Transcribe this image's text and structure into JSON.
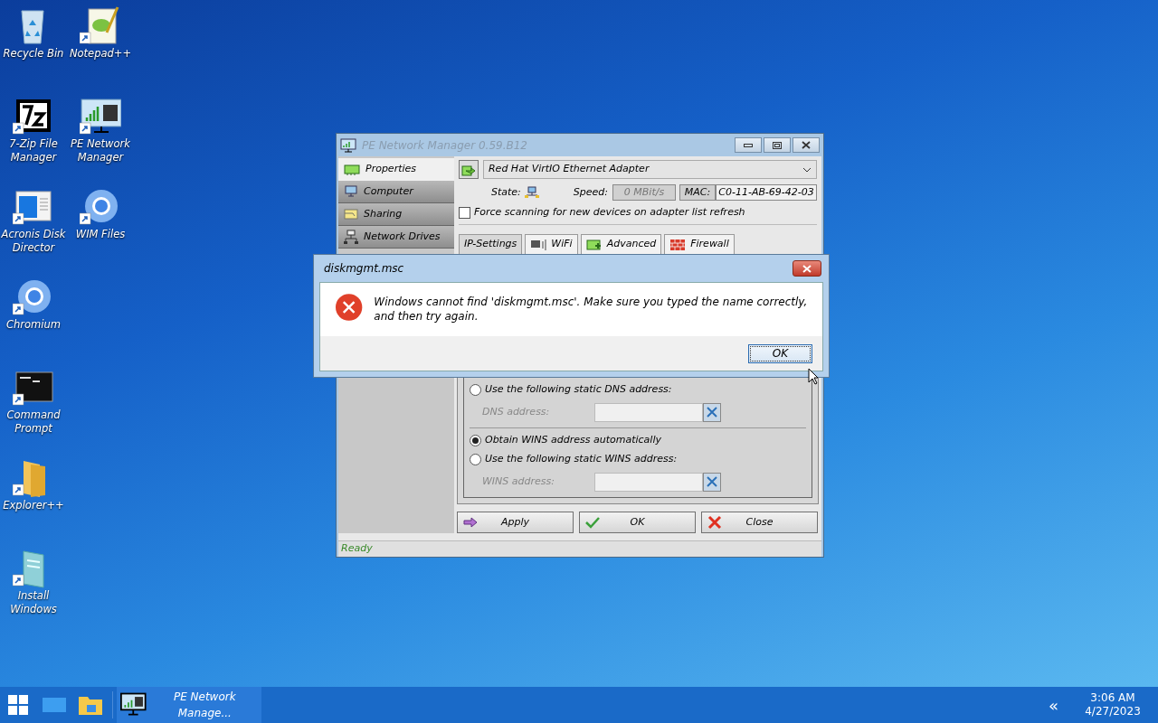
{
  "desktop_icons": [
    {
      "label": "Recycle Bin",
      "shortcut": false
    },
    {
      "label": "7-Zip File Manager",
      "shortcut": true
    },
    {
      "label": "Acronis Disk Director",
      "shortcut": true
    },
    {
      "label": "Chromium",
      "shortcut": true
    },
    {
      "label": "Command Prompt",
      "shortcut": true
    },
    {
      "label": "Explorer++",
      "shortcut": true
    },
    {
      "label": "Install Windows",
      "shortcut": true
    },
    {
      "label": "Notepad++",
      "shortcut": true
    },
    {
      "label": "PE Network Manager",
      "shortcut": true
    },
    {
      "label": "WIM Files",
      "shortcut": true
    }
  ],
  "main_window": {
    "title": "PE Network Manager 0.59.B12",
    "nav": [
      {
        "label": "Properties",
        "selected": true
      },
      {
        "label": "Computer",
        "selected": false
      },
      {
        "label": "Sharing",
        "selected": false
      },
      {
        "label": "Network Drives",
        "selected": false
      }
    ],
    "adapter": "Red Hat VirtIO Ethernet Adapter",
    "state_label": "State:",
    "speed_label": "Speed:",
    "speed": "0 MBit/s",
    "mac_label": "MAC:",
    "mac": "C0-11-AB-69-42-03",
    "force_scan": {
      "label": "Force scanning for new devices on adapter list refresh",
      "checked": false
    },
    "tabs": [
      {
        "label": "IP-Settings",
        "selected": true
      },
      {
        "label": "WiFi",
        "selected": false
      },
      {
        "label": "Advanced",
        "selected": false
      },
      {
        "label": "Firewall",
        "selected": false
      }
    ],
    "sections": [
      {
        "options": [
          {
            "label": "Use the following static DNS address:",
            "selected": false
          }
        ],
        "field_label": "DNS address:"
      },
      {
        "options": [
          {
            "label": "Obtain WINS address automatically",
            "selected": true
          },
          {
            "label": "Use the following static WINS address:",
            "selected": false
          }
        ],
        "field_label": "WINS address:"
      }
    ],
    "buttons": [
      {
        "label": "Apply",
        "kind": "apply"
      },
      {
        "label": "OK",
        "kind": "ok"
      },
      {
        "label": "Close",
        "kind": "close"
      }
    ],
    "status": "Ready"
  },
  "dialog": {
    "title": "diskmgmt.msc",
    "message": "Windows cannot find 'diskmgmt.msc'. Make sure you typed the name correctly, and then try again.",
    "button": "OK"
  },
  "taskbar": {
    "task": "PE Network Manage...",
    "overflow": "«",
    "time": "3:06 AM",
    "date": "4/27/2023"
  }
}
